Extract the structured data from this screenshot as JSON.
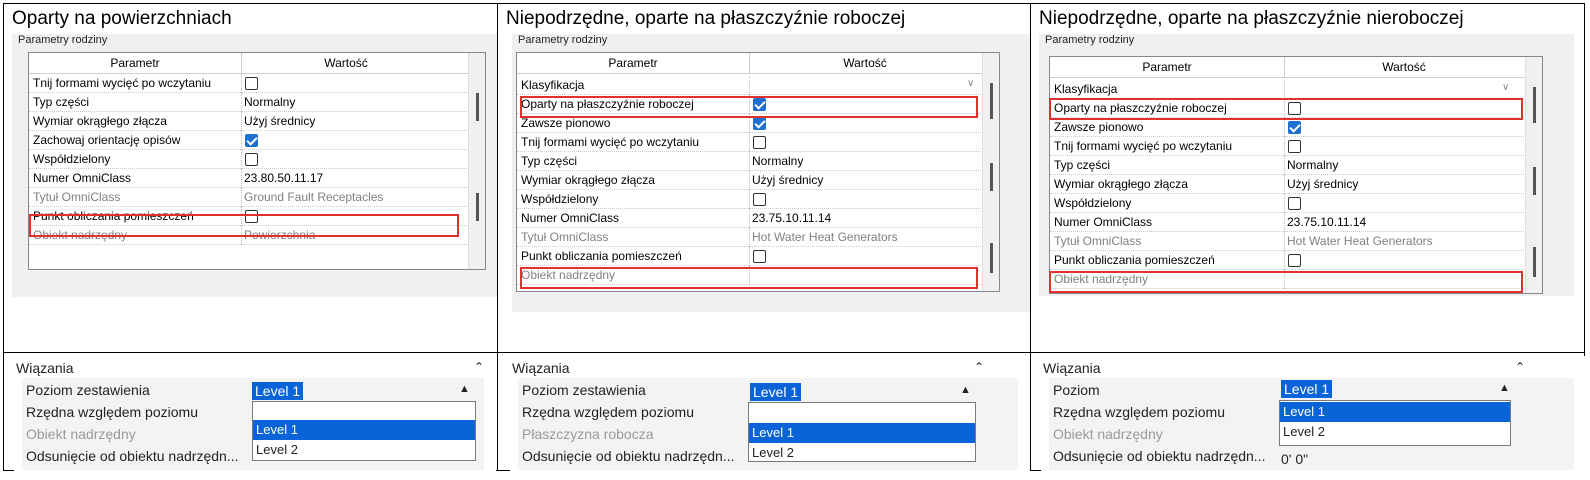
{
  "col1": {
    "title": "Oparty na powierzchniach",
    "family_label": "Parametry rodziny",
    "h_param": "Parametr",
    "h_value": "Wartość",
    "rows": [
      {
        "name": "Tnij formami wycięć po wczytaniu",
        "checkbox": true,
        "checked": false
      },
      {
        "name": "Typ części",
        "value": "Normalny"
      },
      {
        "name": "Wymiar okrągłego złącza",
        "value": "Użyj średnicy"
      },
      {
        "name": "Zachowaj orientację opisów",
        "checkbox": true,
        "checked": true
      },
      {
        "name": "Współdzielony",
        "checkbox": true,
        "checked": false
      },
      {
        "name": "Numer OmniClass",
        "value": "23.80.50.11.17"
      },
      {
        "name": "Tytuł OmniClass",
        "value": "Ground Fault Receptacles",
        "gray": true
      },
      {
        "name": "Punkt obliczania pomieszczeń",
        "checkbox": true,
        "checked": false
      },
      {
        "name": "Obiekt nadrzędny",
        "value": "Powierzchnia",
        "gray": true
      }
    ],
    "wiazania": {
      "title": "Wiązania",
      "rows": [
        {
          "name": "Poziom zestawienia"
        },
        {
          "name": "Rzędna względem poziomu"
        },
        {
          "name": "Obiekt nadrzędny",
          "gray": true
        },
        {
          "name": "Odsunięcie od obiektu nadrzędn..."
        }
      ],
      "selected": "Level 1",
      "options": [
        "Level 1",
        "Level 2"
      ],
      "trailing_value": ""
    }
  },
  "col2": {
    "title": "Niepodrzędne, oparte na płaszczyźnie roboczej",
    "family_label": "Parametry rodziny",
    "h_param": "Parametr",
    "h_value": "Wartość",
    "rows": [
      {
        "name": "Klasyfikacja",
        "collapse": true
      },
      {
        "name": "Oparty na płaszczyźnie roboczej",
        "checkbox": true,
        "checked": true
      },
      {
        "name": "Zawsze pionowo",
        "checkbox": true,
        "checked": true
      },
      {
        "name": "Tnij formami wycięć po wczytaniu",
        "checkbox": true,
        "checked": false
      },
      {
        "name": "Typ części",
        "value": "Normalny"
      },
      {
        "name": "Wymiar okrągłego złącza",
        "value": "Użyj średnicy"
      },
      {
        "name": "Współdzielony",
        "checkbox": true,
        "checked": false
      },
      {
        "name": "Numer OmniClass",
        "value": "23.75.10.11.14"
      },
      {
        "name": "Tytuł OmniClass",
        "value": "Hot Water Heat Generators",
        "gray": true
      },
      {
        "name": "Punkt obliczania pomieszczeń",
        "checkbox": true,
        "checked": false
      },
      {
        "name": "Obiekt nadrzędny",
        "value": "",
        "gray": true
      }
    ],
    "wiazania": {
      "title": "Wiązania",
      "rows": [
        {
          "name": "Poziom zestawienia"
        },
        {
          "name": "Rzędna względem poziomu"
        },
        {
          "name": "Płaszczyzna robocza",
          "gray": true
        },
        {
          "name": "Odsunięcie od obiektu nadrzędn..."
        }
      ],
      "selected": "Level 1",
      "options": [
        "Level 1",
        "Level 2"
      ],
      "trailing_value": ""
    }
  },
  "col3": {
    "title": "Niepodrzędne, oparte na płaszczyźnie nieroboczej",
    "family_label": "Parametry rodziny",
    "h_param": "Parametr",
    "h_value": "Wartość",
    "rows": [
      {
        "name": "Klasyfikacja",
        "collapse": true
      },
      {
        "name": "Oparty na płaszczyźnie roboczej",
        "checkbox": true,
        "checked": false
      },
      {
        "name": "Zawsze pionowo",
        "checkbox": true,
        "checked": true
      },
      {
        "name": "Tnij formami wycięć po wczytaniu",
        "checkbox": true,
        "checked": false
      },
      {
        "name": "Typ części",
        "value": "Normalny"
      },
      {
        "name": "Wymiar okrągłego złącza",
        "value": "Użyj średnicy"
      },
      {
        "name": "Współdzielony",
        "checkbox": true,
        "checked": false
      },
      {
        "name": "Numer OmniClass",
        "value": "23.75.10.11.14"
      },
      {
        "name": "Tytuł OmniClass",
        "value": "Hot Water Heat Generators",
        "gray": true
      },
      {
        "name": "Punkt obliczania pomieszczeń",
        "checkbox": true,
        "checked": false
      },
      {
        "name": "Obiekt nadrzędny",
        "value": "",
        "gray": true
      }
    ],
    "wiazania": {
      "title": "Wiązania",
      "rows": [
        {
          "name": "Poziom"
        },
        {
          "name": "Rzędna względem poziomu"
        },
        {
          "name": "Obiekt nadrzędny",
          "gray": true
        },
        {
          "name": "Odsunięcie od obiektu nadrzędn..."
        }
      ],
      "selected": "Level 1",
      "options": [
        "Level 1",
        "Level 2"
      ],
      "trailing_value": "0'  0\""
    }
  },
  "colors": {
    "highlight": "#e0322d",
    "selection": "#0a64d7",
    "checkbox_on": "#1f6fd0"
  }
}
